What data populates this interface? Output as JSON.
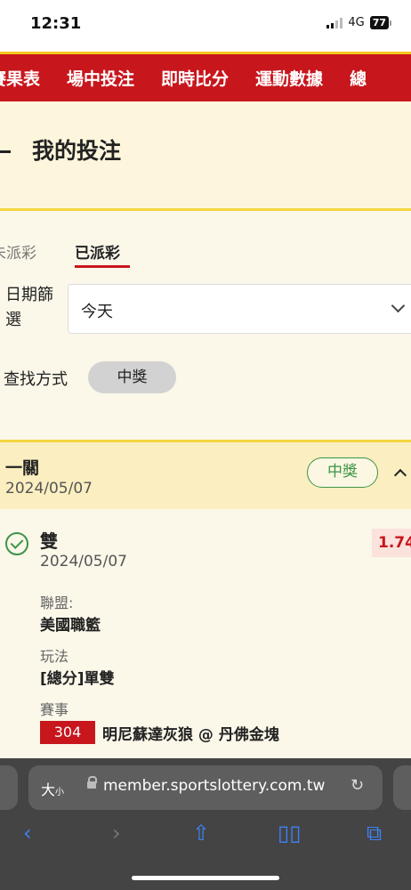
{
  "status": {
    "time": "12:31",
    "network": "4G",
    "battery": "77"
  },
  "nav": {
    "items": [
      "賽果表",
      "場中投注",
      "即時比分",
      "運動數據",
      "總"
    ]
  },
  "header": {
    "title": "我的投注"
  },
  "tabs": {
    "pending": "未派彩",
    "settled": "已派彩"
  },
  "filter": {
    "label": "日期篩選",
    "value": "今天"
  },
  "search": {
    "label": "查找方式",
    "chip": "中獎"
  },
  "card": {
    "type": "一關",
    "date": "2024/05/07",
    "status": "中獎",
    "selection": "雙",
    "selection_date": "2024/05/07",
    "odds": "1.74",
    "league_label": "聯盟:",
    "league": "美國職籃",
    "play_label": "玩法",
    "play": "[總分]單雙",
    "event_label": "賽事",
    "event_no": "304",
    "event": "明尼蘇達灰狼 @ 丹佛金塊"
  },
  "browser": {
    "font_btn": "大",
    "font_btn_small": "小",
    "url": "member.sportslottery.com.tw"
  }
}
